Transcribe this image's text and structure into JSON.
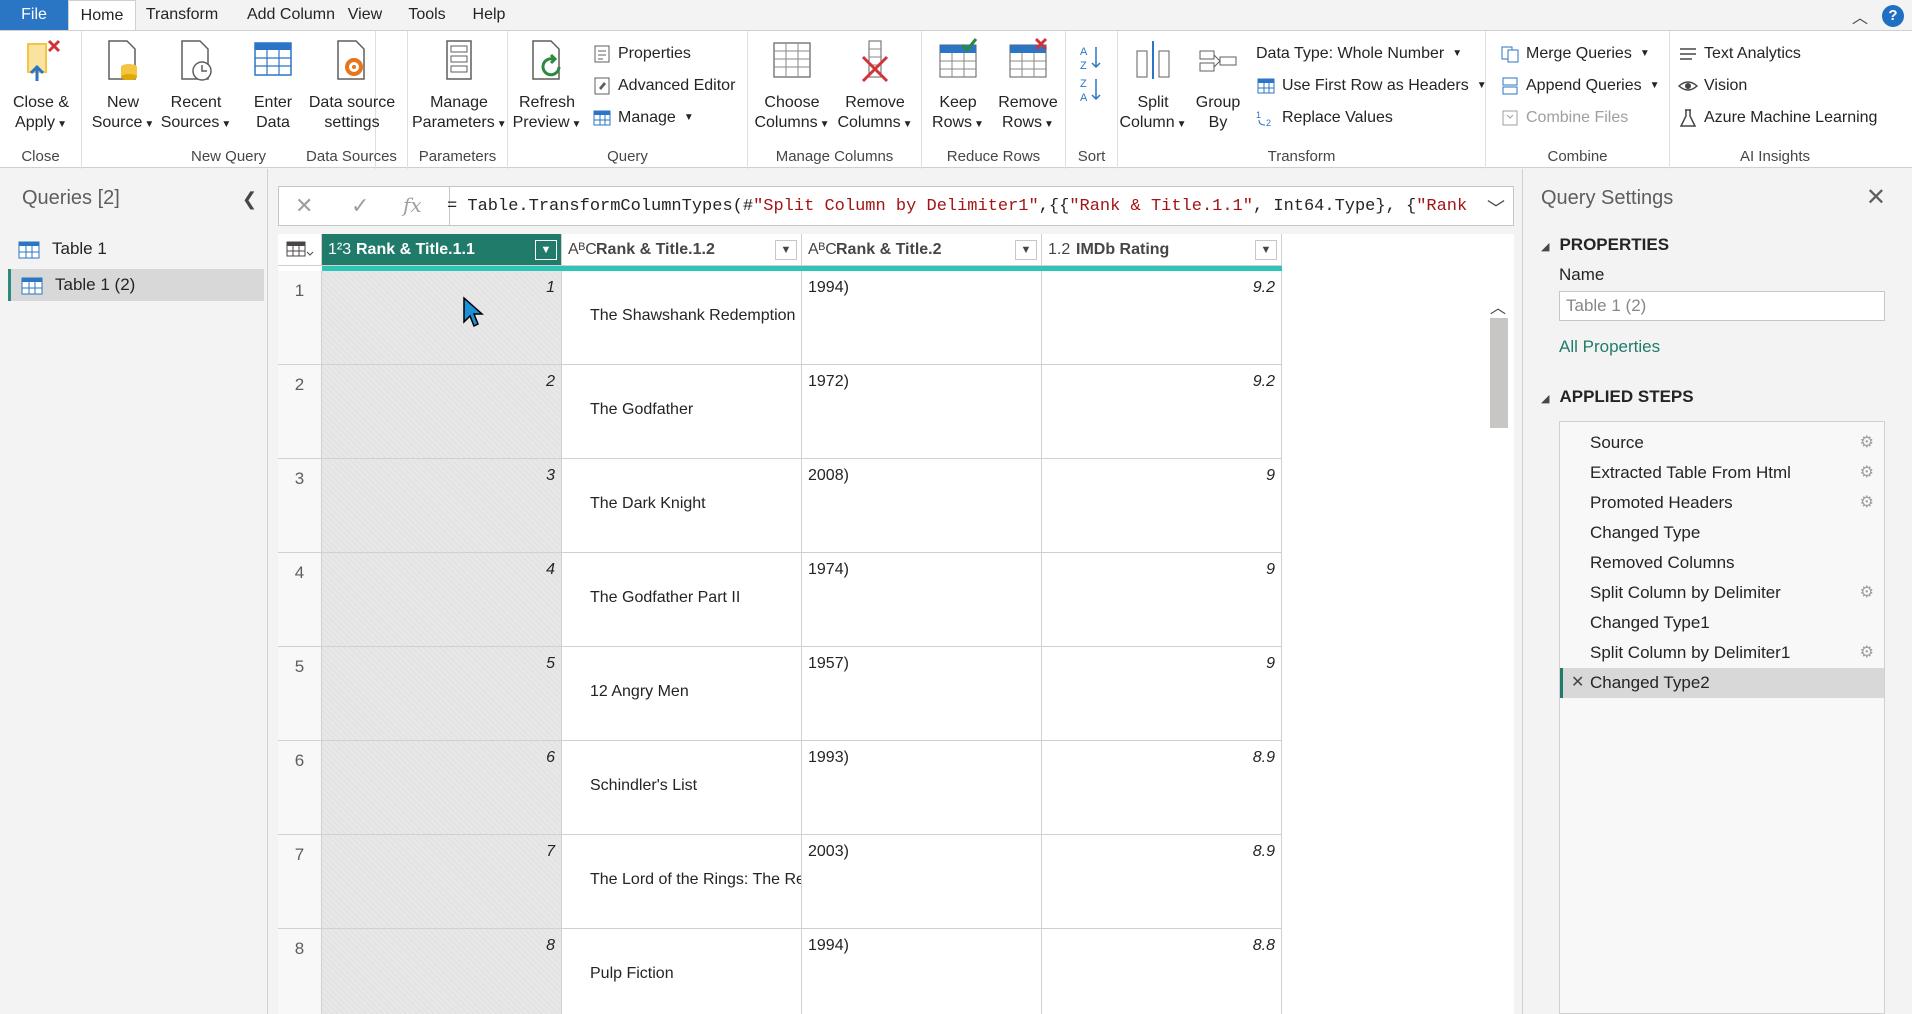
{
  "tabs": {
    "file": "File",
    "home": "Home",
    "transform": "Transform",
    "add_column": "Add Column",
    "view": "View",
    "tools": "Tools",
    "help": "Help"
  },
  "ribbon": {
    "close_group": {
      "label": "Close",
      "close_apply": "Close &",
      "close_apply2": "Apply"
    },
    "new_query_group": {
      "label": "New Query",
      "new_source": "New",
      "new_source2": "Source",
      "recent_sources": "Recent",
      "recent_sources2": "Sources",
      "enter_data": "Enter",
      "enter_data2": "Data"
    },
    "data_sources_group": {
      "label": "Data Sources",
      "ds_settings": "Data source",
      "ds_settings2": "settings"
    },
    "parameters_group": {
      "label": "Parameters",
      "manage_params": "Manage",
      "manage_params2": "Parameters"
    },
    "query_group": {
      "label": "Query",
      "refresh": "Refresh",
      "refresh2": "Preview",
      "properties": "Properties",
      "advanced_editor": "Advanced Editor",
      "manage": "Manage"
    },
    "manage_columns_group": {
      "label": "Manage Columns",
      "choose": "Choose",
      "choose2": "Columns",
      "remove": "Remove",
      "remove2": "Columns"
    },
    "reduce_rows_group": {
      "label": "Reduce Rows",
      "keep": "Keep",
      "keep2": "Rows",
      "remove": "Remove",
      "remove2": "Rows"
    },
    "sort_group": {
      "label": "Sort"
    },
    "transform_group": {
      "label": "Transform",
      "split": "Split",
      "split2": "Column",
      "group": "Group",
      "group2": "By",
      "data_type": "Data Type: Whole Number",
      "first_row": "Use First Row as Headers",
      "replace": "Replace Values"
    },
    "combine_group": {
      "label": "Combine",
      "merge": "Merge Queries",
      "append": "Append Queries",
      "combine_files": "Combine Files"
    },
    "ai_group": {
      "label": "AI Insights",
      "text_analytics": "Text Analytics",
      "vision": "Vision",
      "azure_ml": "Azure Machine Learning"
    }
  },
  "queries": {
    "title": "Queries [2]",
    "items": [
      "Table 1",
      "Table 1 (2)"
    ]
  },
  "formula": {
    "prefix": "= Table.TransformColumnTypes(#",
    "s1": "\"Split Column by Delimiter1\"",
    "mid": ",{{",
    "s2": "\"Rank & Title.1.1\"",
    "mid2": ", Int64.Type}, {",
    "s3": "\"Rank &"
  },
  "grid": {
    "columns": [
      {
        "type": "1²3",
        "name": "Rank & Title.1.1"
      },
      {
        "type": "AᴮC",
        "name": "Rank & Title.1.2"
      },
      {
        "type": "AᴮC",
        "name": "Rank & Title.2"
      },
      {
        "type": "1.2",
        "name": "IMDb Rating"
      }
    ],
    "rows": [
      {
        "n": "1",
        "rank": "1",
        "title": "The Shawshank Redemption",
        "year": "1994)",
        "rating": "9.2"
      },
      {
        "n": "2",
        "rank": "2",
        "title": "The Godfather",
        "year": "1972)",
        "rating": "9.2"
      },
      {
        "n": "3",
        "rank": "3",
        "title": "The Dark Knight",
        "year": "2008)",
        "rating": "9"
      },
      {
        "n": "4",
        "rank": "4",
        "title": "The Godfather Part II",
        "year": "1974)",
        "rating": "9"
      },
      {
        "n": "5",
        "rank": "5",
        "title": "12 Angry Men",
        "year": "1957)",
        "rating": "9"
      },
      {
        "n": "6",
        "rank": "6",
        "title": "Schindler's List",
        "year": "1993)",
        "rating": "8.9"
      },
      {
        "n": "7",
        "rank": "7",
        "title": "The Lord of the Rings: The Re",
        "year": "2003)",
        "rating": "8.9"
      },
      {
        "n": "8",
        "rank": "8",
        "title": "Pulp Fiction",
        "year": "1994)",
        "rating": "8.8"
      }
    ]
  },
  "settings": {
    "title": "Query Settings",
    "properties": "PROPERTIES",
    "name_label": "Name",
    "name_value": "Table 1 (2)",
    "all_properties": "All Properties",
    "applied_steps": "APPLIED STEPS",
    "steps": [
      {
        "label": "Source",
        "gear": true
      },
      {
        "label": "Extracted Table From Html",
        "gear": true
      },
      {
        "label": "Promoted Headers",
        "gear": true
      },
      {
        "label": "Changed Type",
        "gear": false
      },
      {
        "label": "Removed Columns",
        "gear": false
      },
      {
        "label": "Split Column by Delimiter",
        "gear": true
      },
      {
        "label": "Changed Type1",
        "gear": false
      },
      {
        "label": "Split Column by Delimiter1",
        "gear": true
      },
      {
        "label": "Changed Type2",
        "gear": false
      }
    ]
  },
  "colors": {
    "accent": "#217b6b",
    "quality": "#2ec4b6",
    "file_tab": "#2b75c5"
  }
}
